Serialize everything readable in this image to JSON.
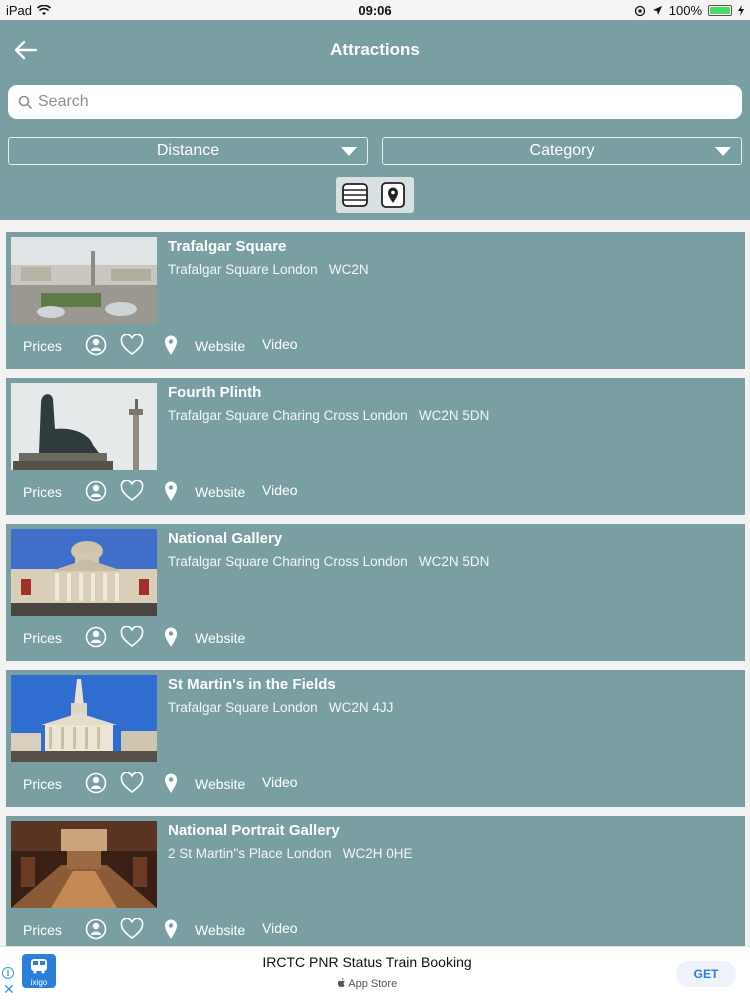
{
  "status_bar": {
    "device": "iPad",
    "time": "09:06",
    "battery": "100%",
    "battery_level": 1.0
  },
  "header": {
    "title": "Attractions",
    "back_icon": "arrow-left-icon"
  },
  "search": {
    "placeholder": "Search",
    "value": ""
  },
  "filters": {
    "distance_label": "Distance",
    "category_label": "Category"
  },
  "view_toggle": {
    "list_icon": "list-view-icon",
    "map_icon": "map-pin-view-icon"
  },
  "attractions": [
    {
      "name": "Trafalgar Square",
      "address": "Trafalgar Square London   WC2N",
      "prices": "Prices",
      "website": "Website",
      "video": "Video"
    },
    {
      "name": "Fourth Plinth",
      "address": "Trafalgar Square Charing Cross London   WC2N 5DN",
      "prices": "Prices",
      "website": "Website",
      "video": "Video"
    },
    {
      "name": "National Gallery",
      "address": "Trafalgar Square Charing Cross London   WC2N 5DN",
      "prices": "Prices",
      "website": "Website",
      "video": ""
    },
    {
      "name": "St Martin's in the Fields",
      "address": "Trafalgar Square London   WC2N 4JJ",
      "prices": "Prices",
      "website": "Website",
      "video": "Video"
    },
    {
      "name": "National Portrait Gallery",
      "address": "2 St Martin''s Place London   WC2H 0HE",
      "prices": "Prices",
      "website": "Website",
      "video": "Video"
    }
  ],
  "ad": {
    "headline": "IRCTC PNR Status Train Booking",
    "store": "App Store",
    "cta": "GET",
    "logo_text": "ixigo"
  },
  "colors": {
    "header": "#7a9fa3",
    "card": "#7a9fa3",
    "text_on_accent": "#ffffff"
  }
}
